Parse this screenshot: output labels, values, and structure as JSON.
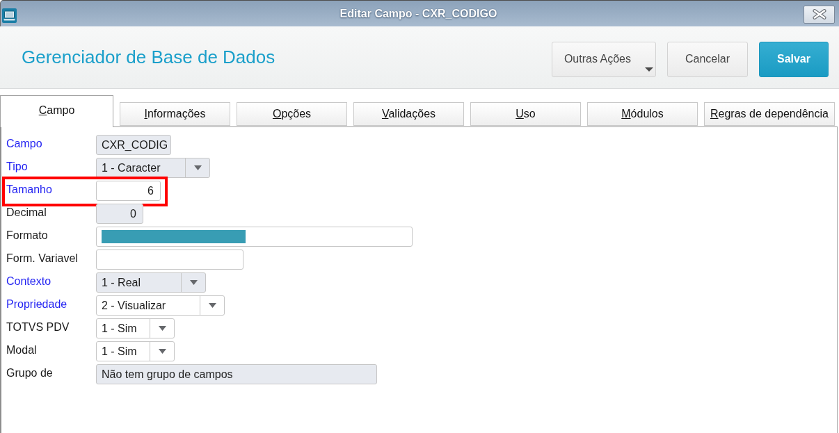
{
  "window": {
    "title": "Editar Campo - CXR_CODIGO"
  },
  "header": {
    "title": "Gerenciador de Base de Dados",
    "buttons": [
      {
        "label": "Outras Ações",
        "kind": "menu"
      },
      {
        "label": "Cancelar",
        "kind": "secondary"
      },
      {
        "label": "Salvar",
        "kind": "primary"
      }
    ]
  },
  "tabs": [
    {
      "label": "Campo",
      "selected": true
    },
    {
      "label": "Informações",
      "selected": false
    },
    {
      "label": "Opções",
      "selected": false
    },
    {
      "label": "Validações",
      "selected": false
    },
    {
      "label": "Uso",
      "selected": false
    },
    {
      "label": "Módulos",
      "selected": false
    },
    {
      "label": "Regras de dependência",
      "selected": false
    }
  ],
  "fields": [
    {
      "label": "Campo",
      "required": true,
      "kind": "text",
      "value": "CXR_CODIG",
      "disabled": true,
      "highlighted": false,
      "redacted": false
    },
    {
      "label": "Tipo",
      "required": true,
      "kind": "select",
      "value": "1 - Caracter",
      "disabled": true,
      "highlighted": false,
      "redacted": false
    },
    {
      "label": "Tamanho",
      "required": true,
      "kind": "number",
      "value": "6",
      "disabled": false,
      "highlighted": true,
      "redacted": false
    },
    {
      "label": "Decimal",
      "required": false,
      "kind": "number",
      "value": "0",
      "disabled": true,
      "highlighted": false,
      "redacted": false
    },
    {
      "label": "Formato",
      "required": false,
      "kind": "text",
      "disabled": false,
      "highlighted": false,
      "redacted": true
    },
    {
      "label": "Form. Variavel",
      "required": false,
      "kind": "text",
      "disabled": false,
      "highlighted": false,
      "redacted": false
    },
    {
      "label": "Contexto",
      "required": true,
      "kind": "select",
      "value": "1 - Real",
      "disabled": true,
      "highlighted": false,
      "redacted": false
    },
    {
      "label": "Propriedade",
      "required": true,
      "kind": "select",
      "value": "2 - Visualizar",
      "disabled": false,
      "highlighted": false,
      "redacted": false
    },
    {
      "label": "TOTVS PDV",
      "required": false,
      "kind": "select",
      "value": "1 - Sim",
      "disabled": false,
      "highlighted": false,
      "redacted": false
    },
    {
      "label": "Modal",
      "required": false,
      "kind": "select",
      "value": "1 - Sim",
      "disabled": false,
      "highlighted": false,
      "redacted": false
    },
    {
      "label": "Grupo de",
      "required": false,
      "kind": "text",
      "value": "Não tem grupo de campos",
      "disabled": true,
      "highlighted": false,
      "redacted": false
    }
  ]
}
